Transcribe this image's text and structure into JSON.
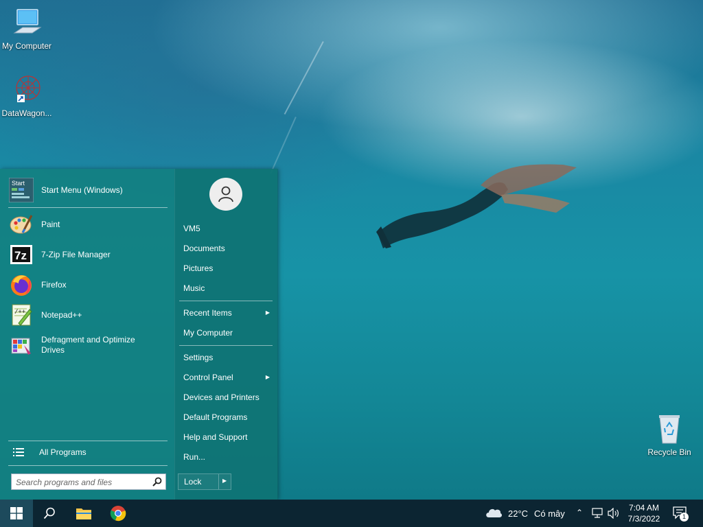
{
  "desktop": {
    "icons": [
      {
        "label": "My Computer",
        "icon": "computer-icon"
      },
      {
        "label": "DataWagon...",
        "icon": "network-shortcut-icon"
      },
      {
        "label": "Recycle Bin",
        "icon": "recycle-bin-icon"
      }
    ]
  },
  "start_menu": {
    "pinned": [
      {
        "label": "Start Menu (Windows)",
        "icon": "start-menu-icon"
      }
    ],
    "programs": [
      {
        "label": "Paint",
        "icon": "paint-icon"
      },
      {
        "label": "7-Zip File Manager",
        "icon": "7zip-icon"
      },
      {
        "label": "Firefox",
        "icon": "firefox-icon"
      },
      {
        "label": "Notepad++",
        "icon": "notepadpp-icon"
      },
      {
        "label": "Defragment and Optimize Drives",
        "icon": "defrag-icon"
      }
    ],
    "all_programs_label": "All Programs",
    "search_placeholder": "Search programs and files",
    "user_name": "VM5",
    "right_items": {
      "documents": "Documents",
      "pictures": "Pictures",
      "music": "Music",
      "recent_items": "Recent Items",
      "my_computer": "My Computer",
      "settings": "Settings",
      "control_panel": "Control Panel",
      "devices_printers": "Devices and Printers",
      "default_programs": "Default Programs",
      "help_support": "Help and Support",
      "run": "Run..."
    },
    "lock_label": "Lock"
  },
  "taskbar": {
    "pinned": [
      "search-icon",
      "file-explorer-icon",
      "chrome-icon"
    ],
    "weather_temp": "22°C",
    "weather_desc": "Có mây",
    "time": "7:04 AM",
    "date": "7/3/2022",
    "notification_count": "1"
  },
  "colors": {
    "start_menu_bg": "#128080",
    "taskbar_bg": "#0c2532",
    "accent": "#1d4a5c"
  }
}
